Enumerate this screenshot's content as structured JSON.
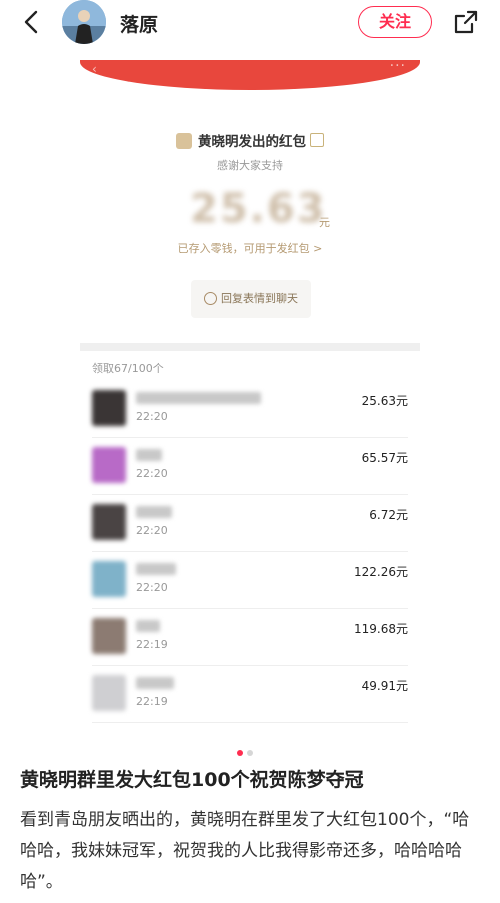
{
  "header": {
    "author_name": "落原",
    "follow_label": "关注",
    "back_icon": "chevron-left-icon",
    "share_icon": "share-icon",
    "accent_color": "#ff2d50"
  },
  "red_packet": {
    "sender_title": "黄晓明发出的红包",
    "greeting": "感谢大家支持",
    "amount": "25.63",
    "currency": "元",
    "saved_text": "已存入零钱，可用于发红包 >",
    "reply_label": "回复表情到聊天",
    "claim_count": "领取67/100个",
    "header_color": "#e8473d",
    "claims": [
      {
        "time": "22:20",
        "amount": "25.63元"
      },
      {
        "time": "22:20",
        "amount": "65.57元"
      },
      {
        "time": "22:20",
        "amount": "6.72元"
      },
      {
        "time": "22:20",
        "amount": "122.26元"
      },
      {
        "time": "22:19",
        "amount": "119.68元"
      },
      {
        "time": "22:19",
        "amount": "49.91元"
      }
    ]
  },
  "carousel": {
    "current": 1,
    "total": 2
  },
  "post": {
    "title": "黄晓明群里发大红包100个祝贺陈梦夺冠",
    "body": "看到青岛朋友晒出的，黄晓明在群里发了大红包100个，“哈哈哈，我妹妹冠军，祝贺我的人比我得影帝还多，哈哈哈哈哈”。"
  }
}
